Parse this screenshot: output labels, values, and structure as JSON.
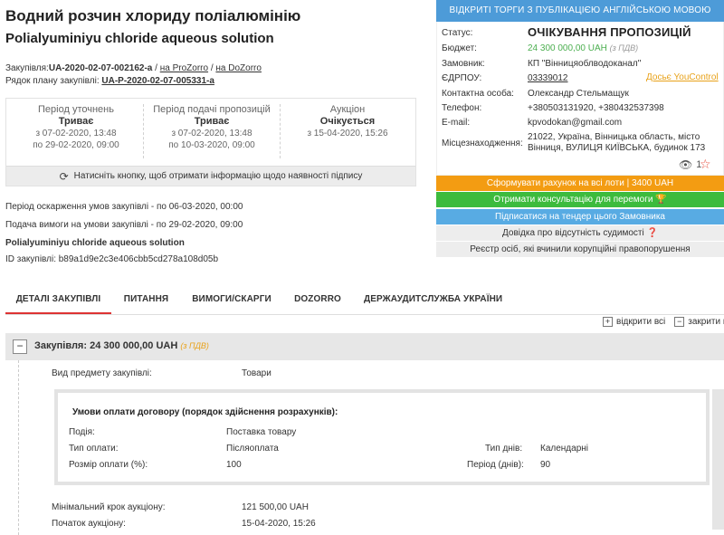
{
  "header": {
    "title_ua": "Водний розчин хлориду поліалюмінію",
    "title_en": "Polialyuminiyu chloride aqueous solution",
    "tender_label": "Закупівля:",
    "tender_id": "UA-2020-02-07-002162-a",
    "sep": "/",
    "prozorro_link": "на ProZorro",
    "dozorro_link": "на DoZorro",
    "plan_label": "Рядок плану закупівлі:",
    "plan_id": "UA-P-2020-02-07-005331-a"
  },
  "periods": [
    {
      "title": "Період уточнень",
      "status": "Триває",
      "from": "з 07-02-2020, 13:48",
      "to": "по 29-02-2020, 09:00"
    },
    {
      "title": "Період подачі пропозицій",
      "status": "Триває",
      "from": "з 07-02-2020, 13:48",
      "to": "по 10-03-2020, 09:00"
    },
    {
      "title": "Аукціон",
      "status": "Очікується",
      "from": "з 15-04-2020, 15:26",
      "to": ""
    }
  ],
  "signature_button": "Натисніть кнопку, щоб отримати інформацію щодо наявності підпису",
  "info": {
    "appeal": "Період оскарження умов закупівлі - по 06-03-2020, 00:00",
    "claims": "Подача вимоги на умови закупівлі - по 29-02-2020, 09:00",
    "name_en": "Polialyuminiyu chloride aqueous solution",
    "procurement_id": "ID закупівлі: b89a1d9e2c3e406cbb5cd278a108d05b"
  },
  "right_panel": {
    "header": "ВІДКРИТІ ТОРГИ З ПУБЛІКАЦІЄЮ АНГЛІЙСЬКОЮ МОВОЮ",
    "status_label": "Статус:",
    "status_value": "ОЧІКУВАННЯ ПРОПОЗИЦІЙ",
    "budget_label": "Бюджет:",
    "budget_value": "24 300 000,00 UAH",
    "budget_vat": "(з ПДВ)",
    "customer_label": "Замовник:",
    "customer_value": "КП \"Вінницяоблводоканал\"",
    "edrpou_label": "ЄДРПОУ:",
    "edrpou_value": "03339012",
    "dossier_link": "Досьє YouControl",
    "contact_label": "Контактна особа:",
    "contact_value": "Олександр Стельмащук",
    "phone_label": "Телефон:",
    "phone_value": "+380503131920, +380432537398",
    "email_label": "E-mail:",
    "email_value": "kpvodokan@gmail.com",
    "location_label": "Місцезнаходження:",
    "location_line1": "21022, Україна, Вінницька область, місто",
    "location_line2": "Вінниця, ВУЛИЦЯ КИЇВСЬКА, будинок 173",
    "views": "1",
    "btn_invoice": "Сформувати рахунок на всі лоти | 3400 UAH",
    "btn_consult": "Отримати консультацію для перемоги 🏆",
    "btn_subscribe": "Підписатися на тендер цього Замовника",
    "btn_court": "Довідка про відсутність судимості ❓",
    "btn_registry": "Реєстр осіб, які вчинили корупційні правопорушення"
  },
  "tabs": [
    {
      "label": "ДЕТАЛІ ЗАКУПІВЛІ",
      "active": true
    },
    {
      "label": "ПИТАННЯ",
      "active": false
    },
    {
      "label": "ВИМОГИ/СКАРГИ",
      "active": false
    },
    {
      "label": "DOZORRO",
      "active": false
    },
    {
      "label": "ДЕРЖАУДИТСЛУЖБА УКРАЇНИ",
      "active": false
    }
  ],
  "expand": {
    "open_all": "відкрити всі",
    "close_all": "закрити всі"
  },
  "tender": {
    "title": "Закупівля: 24 300 000,00 UAH",
    "vat": "(з ПДВ)",
    "subject_label": "Вид предмету закупівлі:",
    "subject_value": "Товари",
    "payment": {
      "title": "Умови оплати договору (порядок здійснення розрахунків):",
      "event_label": "Подія:",
      "event_value": "Поставка товару",
      "type_label": "Тип оплати:",
      "type_value": "Післяоплата",
      "days_type_label": "Тип днів:",
      "days_type_value": "Календарні",
      "size_label": "Розмір оплати (%):",
      "size_value": "100",
      "period_label": "Період (днів):",
      "period_value": "90"
    },
    "min_step_label": "Мінімальний крок аукціону:",
    "min_step_value": "121 500,00 UAH",
    "auction_start_label": "Початок аукціону:",
    "auction_start_value": "15-04-2020, 15:26"
  }
}
